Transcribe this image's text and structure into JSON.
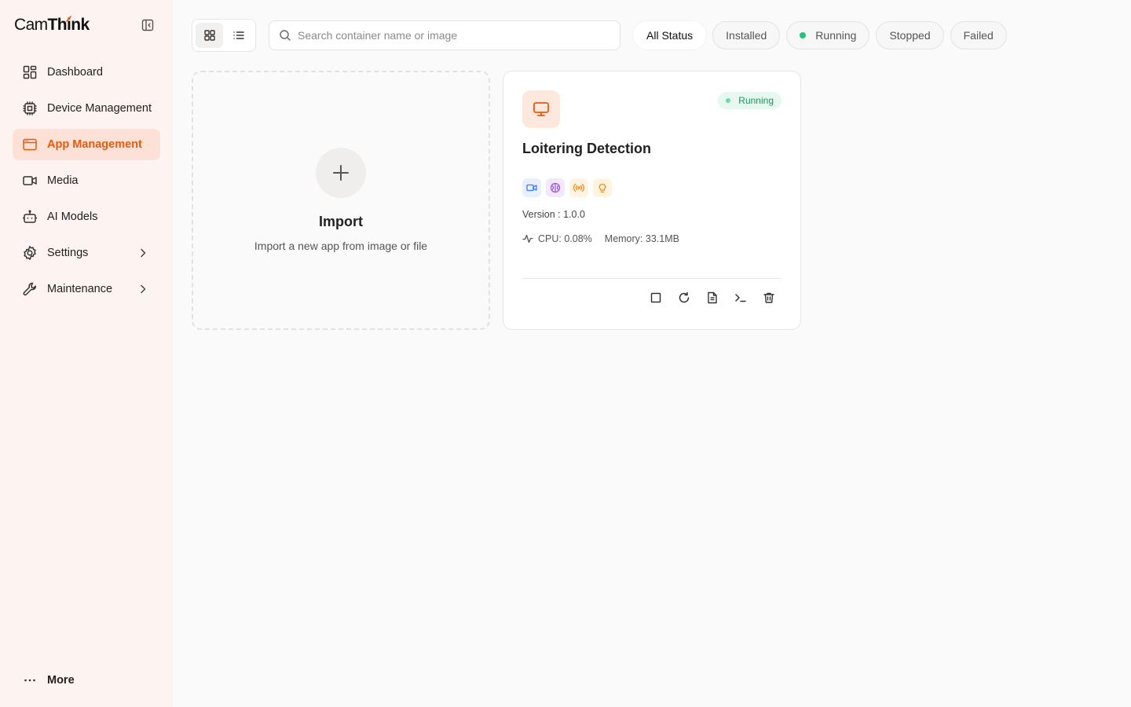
{
  "brand": {
    "name_light": "Cam",
    "name_bold": "Think",
    "logo_icon": "camthink-logo"
  },
  "sidebar": {
    "collapse_icon": "sidebar-collapse-icon",
    "items": [
      {
        "label": "Dashboard",
        "icon": "dashboard-grid-icon",
        "active": false
      },
      {
        "label": "Device Management",
        "icon": "chip-icon",
        "active": false
      },
      {
        "label": "App Management",
        "icon": "app-window-icon",
        "active": true
      },
      {
        "label": "Media",
        "icon": "video-camera-icon",
        "active": false
      },
      {
        "label": "AI Models",
        "icon": "robot-icon",
        "active": false
      },
      {
        "label": "Settings",
        "icon": "gear-icon",
        "active": false,
        "expandable": true
      },
      {
        "label": "Maintenance",
        "icon": "wrench-icon",
        "active": false,
        "expandable": true
      }
    ],
    "more_label": "More"
  },
  "toolbar": {
    "view_modes": [
      "grid",
      "list"
    ],
    "active_view": "grid",
    "search": {
      "placeholder": "Search container name or image",
      "value": ""
    },
    "filters": [
      {
        "label": "All Status",
        "active": true
      },
      {
        "label": "Installed",
        "active": false
      },
      {
        "label": "Running",
        "active": false,
        "dot_color": "#22c47a"
      },
      {
        "label": "Stopped",
        "active": false
      },
      {
        "label": "Failed",
        "active": false
      }
    ]
  },
  "import_card": {
    "title": "Import",
    "subtitle": "Import a new app from image or file"
  },
  "apps": [
    {
      "name": "Loitering Detection",
      "icon": "monitor-icon",
      "status": "Running",
      "version_text": "Version : 1.0.0",
      "cpu_text": "CPU: 0.08%",
      "memory_text": "Memory: 33.1MB",
      "tags": [
        "video-camera-icon",
        "ai-brain-icon",
        "broadcast-icon",
        "lightbulb-icon"
      ],
      "actions": [
        "stop-icon",
        "restart-icon",
        "logs-icon",
        "terminal-icon",
        "trash-icon"
      ]
    }
  ],
  "colors": {
    "accent": "#e8590c",
    "sidebar_bg": "#fdf3f0",
    "active_bg": "#fde1d6",
    "running_green": "#22c47a"
  }
}
